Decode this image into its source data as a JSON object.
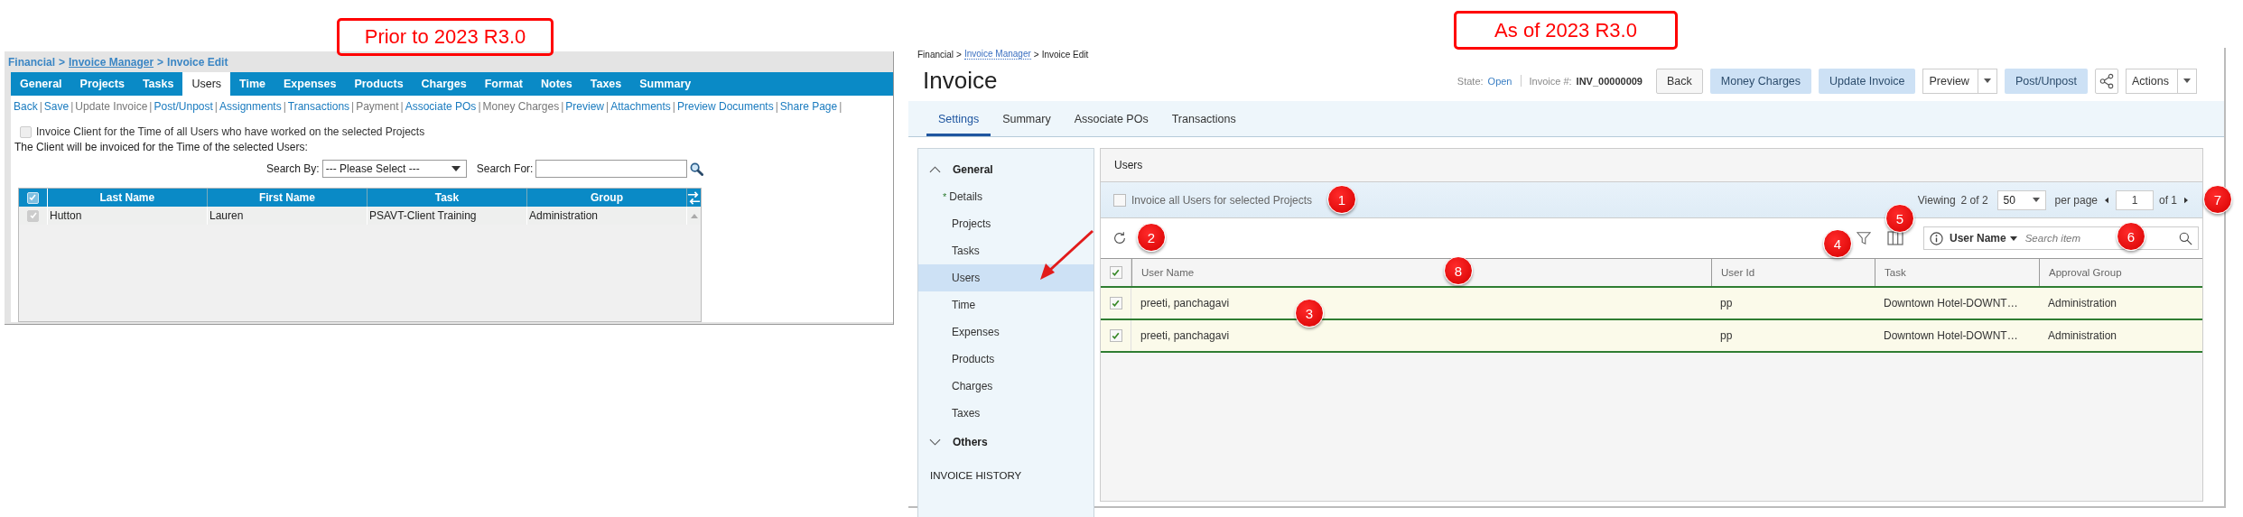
{
  "old_version": {
    "label": "Prior to 2023 R3.0",
    "breadcrumb": {
      "separator": ">",
      "items": [
        {
          "text": "Financial",
          "link": false
        },
        {
          "text": "Invoice Manager",
          "link": true
        },
        {
          "text": "Invoice Edit",
          "link": false
        }
      ]
    },
    "tabs": [
      {
        "label": "General",
        "selected": false
      },
      {
        "label": "Projects",
        "selected": false
      },
      {
        "label": "Tasks",
        "selected": false
      },
      {
        "label": "Users",
        "selected": true
      },
      {
        "label": "Time",
        "selected": false
      },
      {
        "label": "Expenses",
        "selected": false
      },
      {
        "label": "Products",
        "selected": false
      },
      {
        "label": "Charges",
        "selected": false
      },
      {
        "label": "Format",
        "selected": false
      },
      {
        "label": "Notes",
        "selected": false
      },
      {
        "label": "Taxes",
        "selected": false
      },
      {
        "label": "Summary",
        "selected": false
      }
    ],
    "actions": {
      "separator": "|",
      "items": [
        {
          "text": "Back",
          "disabled": false
        },
        {
          "text": "Save",
          "disabled": false
        },
        {
          "text": "Update Invoice",
          "disabled": true
        },
        {
          "text": "Post/Unpost",
          "disabled": false
        },
        {
          "text": "Assignments",
          "disabled": false
        },
        {
          "text": "Transactions",
          "disabled": false
        },
        {
          "text": "Payment",
          "disabled": true
        },
        {
          "text": "Associate POs",
          "disabled": false
        },
        {
          "text": "Money Charges",
          "disabled": true
        },
        {
          "text": "Preview",
          "disabled": false
        },
        {
          "text": "Attachments",
          "disabled": false
        },
        {
          "text": "Preview Documents",
          "disabled": false
        },
        {
          "text": "Share Page",
          "disabled": false
        }
      ]
    },
    "invoice_all": {
      "label": "Invoice Client for the Time of all Users who have worked on the selected Projects",
      "checked": false,
      "disabled": true
    },
    "note": "The Client will be invoiced for the Time of the selected Users:",
    "search": {
      "by_label": "Search By:",
      "by_value": "--- Please Select ---",
      "for_label": "Search For:"
    },
    "table": {
      "header_checked": true,
      "columns": [
        "Last Name",
        "First Name",
        "Task",
        "Group"
      ],
      "rows": [
        {
          "checked": true,
          "cells": [
            "Hutton",
            "Lauren",
            "PSAVT-Client Training",
            "Administration"
          ]
        }
      ]
    }
  },
  "new_version": {
    "label": "As of 2023 R3.0",
    "breadcrumb": {
      "separator": ">",
      "items": [
        {
          "text": "Financial",
          "link": false
        },
        {
          "text": "Invoice Manager",
          "link": true
        },
        {
          "text": "Invoice Edit",
          "link": false
        }
      ]
    },
    "title": "Invoice",
    "state": {
      "label": "State:",
      "value": "Open"
    },
    "invoice_number": {
      "label": "Invoice #:",
      "value": "INV_00000009"
    },
    "buttons": [
      {
        "label": "Back",
        "kind": "plain"
      },
      {
        "label": "Money Charges",
        "kind": "primary"
      },
      {
        "label": "Update Invoice",
        "kind": "primary"
      },
      {
        "label": "Preview",
        "kind": "split"
      },
      {
        "label": "Post/Unpost",
        "kind": "primary"
      },
      {
        "kind": "share"
      },
      {
        "label": "Actions",
        "kind": "split"
      }
    ],
    "tabs": [
      {
        "label": "Settings",
        "selected": true
      },
      {
        "label": "Summary",
        "selected": false
      },
      {
        "label": "Associate POs",
        "selected": false
      },
      {
        "label": "Transactions",
        "selected": false
      }
    ],
    "sidebar": {
      "groups": [
        {
          "label": "General",
          "expanded": true,
          "items": [
            {
              "label": "Details",
              "marker": "*",
              "selected": false
            },
            {
              "label": "Projects",
              "selected": false
            },
            {
              "label": "Tasks",
              "selected": false
            },
            {
              "label": "Users",
              "selected": true
            },
            {
              "label": "Time",
              "selected": false
            },
            {
              "label": "Expenses",
              "selected": false
            },
            {
              "label": "Products",
              "selected": false
            },
            {
              "label": "Charges",
              "selected": false
            },
            {
              "label": "Taxes",
              "selected": false
            }
          ]
        },
        {
          "label": "Others",
          "expanded": false
        }
      ],
      "history": "INVOICE HISTORY"
    },
    "panel_title": "Users",
    "invoice_all": {
      "label": "Invoice all Users for selected Projects",
      "checked": false
    },
    "pagination": {
      "viewing_label": "Viewing",
      "viewing_value": "2 of 2",
      "per_page_value": "50",
      "per_page_label": "per page",
      "page": "1",
      "of_pages": "of 1"
    },
    "search": {
      "field": "User Name",
      "placeholder": "Search item"
    },
    "grid": {
      "header_checked": true,
      "columns": [
        "User Name",
        "User Id",
        "Task",
        "Approval Group"
      ],
      "rows": [
        {
          "checked": true,
          "cells": [
            "preeti, panchagavi",
            "pp",
            "Downtown Hotel-DOWNT…",
            "Administration"
          ]
        },
        {
          "checked": true,
          "cells": [
            "preeti, panchagavi",
            "pp",
            "Downtown Hotel-DOWNT…",
            "Administration"
          ]
        }
      ]
    }
  },
  "callouts": [
    "1",
    "2",
    "3",
    "4",
    "5",
    "6",
    "7",
    "8"
  ]
}
